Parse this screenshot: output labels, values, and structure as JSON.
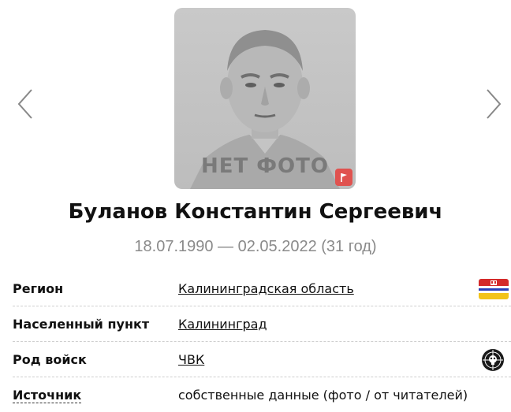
{
  "photo": {
    "caption": "НЕТ ФОТО"
  },
  "person": {
    "name": "Буланов Константин Сергеевич",
    "dates": "18.07.1990 — 02.05.2022 (31 год)"
  },
  "info": {
    "rows": [
      {
        "label": "Регион",
        "value": "Калининградская область",
        "icon": "region-flag-icon"
      },
      {
        "label": "Населенный пункт",
        "value": "Калининград"
      },
      {
        "label": "Род войск",
        "value": "ЧВК",
        "icon": "pmc-emblem-icon"
      },
      {
        "label": "Источник",
        "value": "собственные данные (фото / от читателей)"
      }
    ]
  },
  "colors": {
    "report_flag": "#e0524f",
    "muted_text": "#8a8a8a"
  }
}
